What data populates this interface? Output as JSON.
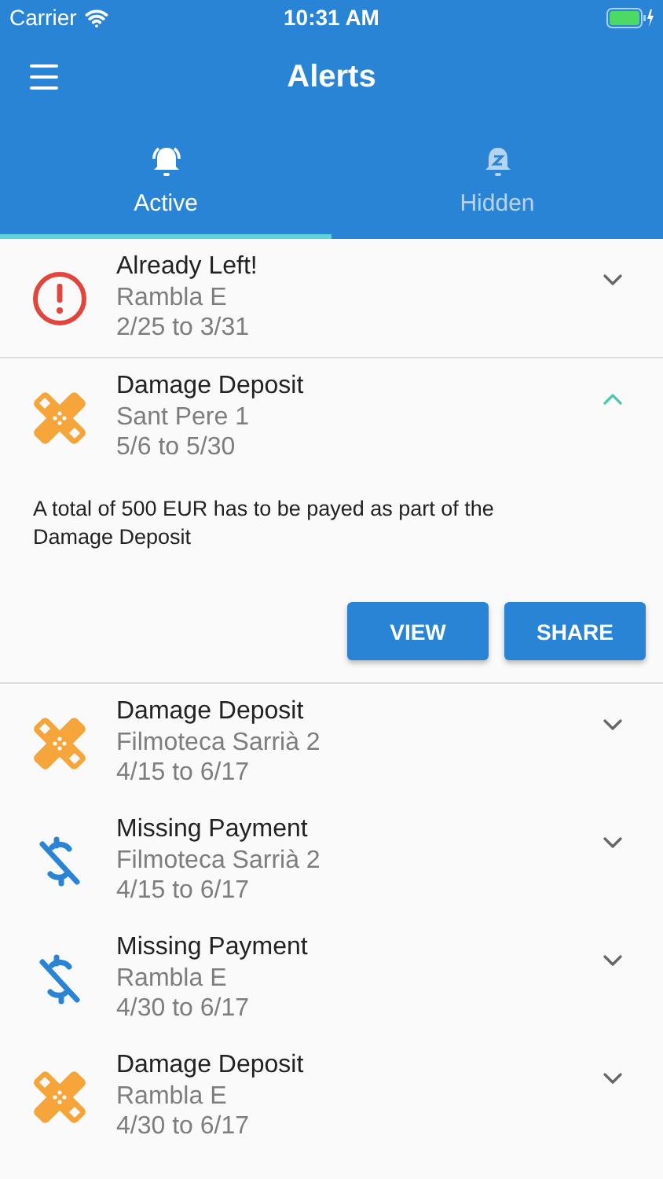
{
  "status_bar": {
    "carrier": "Carrier",
    "time": "10:31 AM"
  },
  "header": {
    "title": "Alerts"
  },
  "tabs": [
    {
      "label": "Active",
      "selected": true
    },
    {
      "label": "Hidden",
      "selected": false
    }
  ],
  "alerts": [
    {
      "kind": "alert",
      "title": "Already Left!",
      "place": "Rambla E",
      "dates": "2/25 to 3/31",
      "expanded": false
    },
    {
      "kind": "deposit",
      "title": "Damage Deposit",
      "place": "Sant Pere 1",
      "dates": "5/6 to 5/30",
      "expanded": true,
      "description": "A total of 500 EUR has to be payed as part of the Damage Deposit",
      "buttons": [
        "VIEW",
        "SHARE"
      ]
    },
    {
      "kind": "deposit",
      "title": "Damage Deposit",
      "place": "Filmoteca Sarrià 2",
      "dates": "4/15 to 6/17",
      "expanded": false
    },
    {
      "kind": "payment",
      "title": "Missing Payment",
      "place": "Filmoteca Sarrià 2",
      "dates": "4/15 to 6/17",
      "expanded": false
    },
    {
      "kind": "payment",
      "title": "Missing Payment",
      "place": "Rambla E",
      "dates": "4/30 to 6/17",
      "expanded": false
    },
    {
      "kind": "deposit",
      "title": "Damage Deposit",
      "place": "Rambla E",
      "dates": "4/30 to 6/17",
      "expanded": false
    }
  ]
}
